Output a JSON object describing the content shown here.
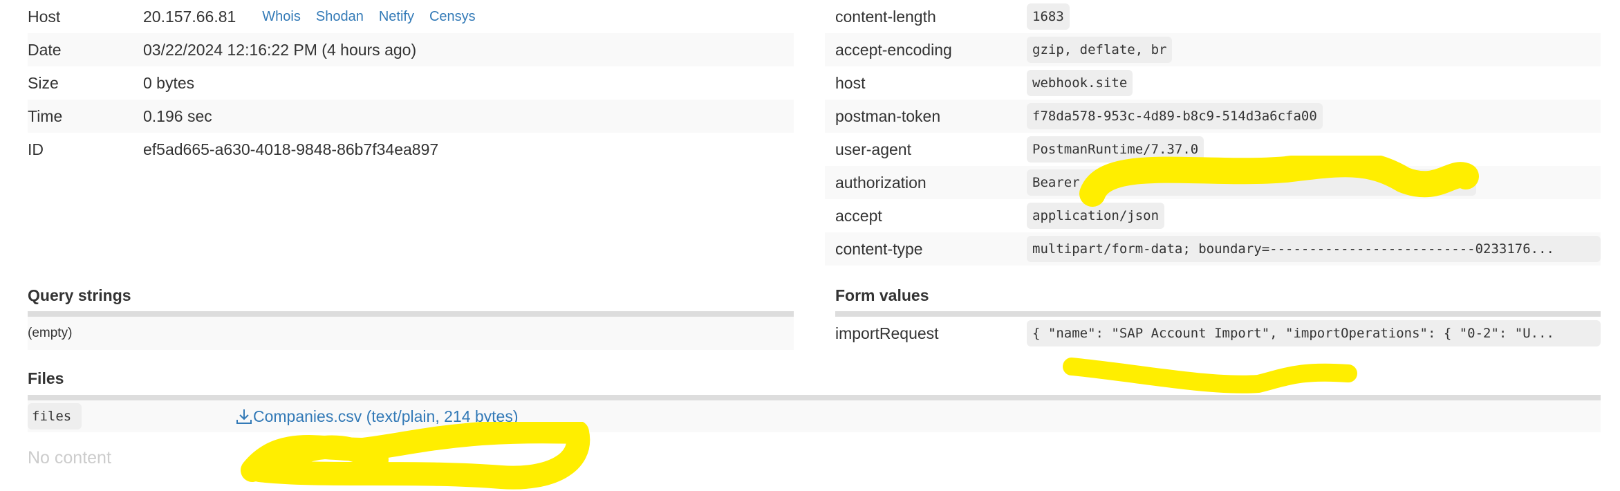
{
  "request": {
    "host_label": "Host",
    "host": "20.157.66.81",
    "links": [
      "Whois",
      "Shodan",
      "Netify",
      "Censys"
    ],
    "date_label": "Date",
    "date": "03/22/2024 12:16:22 PM (4 hours ago)",
    "size_label": "Size",
    "size": "0 bytes",
    "time_label": "Time",
    "time": "0.196 sec",
    "id_label": "ID",
    "id": "ef5ad665-a630-4018-9848-86b7f34ea897"
  },
  "headers": [
    {
      "name": "content-length",
      "value": "1683"
    },
    {
      "name": "accept-encoding",
      "value": "gzip, deflate, br"
    },
    {
      "name": "host",
      "value": "webhook.site"
    },
    {
      "name": "postman-token",
      "value": "f78da578-953c-4d89-b8c9-514d3a6cfa00"
    },
    {
      "name": "user-agent",
      "value": "PostmanRuntime/7.37.0"
    },
    {
      "name": "authorization",
      "value": "Bearer"
    },
    {
      "name": "accept",
      "value": "application/json"
    },
    {
      "name": "content-type",
      "value": "multipart/form-data; boundary=--------------------------0233176..."
    }
  ],
  "query": {
    "title": "Query strings",
    "empty": "(empty)"
  },
  "form": {
    "title": "Form values",
    "items": [
      {
        "name": "importRequest",
        "value": "{ \"name\": \"SAP Account Import\", \"importOperations\": { \"0-2\": \"U..."
      }
    ]
  },
  "files": {
    "title": "Files",
    "key": "files",
    "file": "Companies.csv (text/plain, 214 bytes)",
    "no_content": "No content"
  },
  "colors": {
    "link": "#337ab7",
    "redaction": "#ffee00"
  }
}
